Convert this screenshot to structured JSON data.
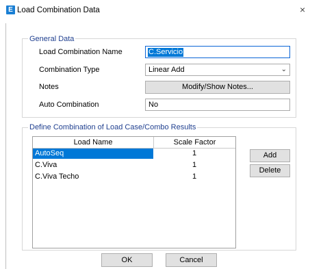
{
  "window": {
    "icon_letter": "E",
    "title": "Load Combination Data",
    "close_glyph": "×"
  },
  "general": {
    "section_title": "General Data",
    "name_label": "Load Combination Name",
    "name_value": "C.Servicio",
    "type_label": "Combination Type",
    "type_value": "Linear Add",
    "notes_label": "Notes",
    "notes_button": "Modify/Show Notes...",
    "auto_label": "Auto Combination",
    "auto_value": "No"
  },
  "define": {
    "section_title": "Define Combination of Load Case/Combo Results",
    "columns": [
      "Load Name",
      "Scale Factor"
    ],
    "rows": [
      {
        "name": "AutoSeq",
        "scale": "1",
        "selected": true
      },
      {
        "name": "C.Viva",
        "scale": "1",
        "selected": false
      },
      {
        "name": "C.Viva Techo",
        "scale": "1",
        "selected": false
      }
    ],
    "add_button": "Add",
    "delete_button": "Delete"
  },
  "footer": {
    "ok": "OK",
    "cancel": "Cancel"
  },
  "colors": {
    "selection": "#0078d7",
    "section_text": "#1f3f8f",
    "app_icon": "#1a7fd4"
  }
}
